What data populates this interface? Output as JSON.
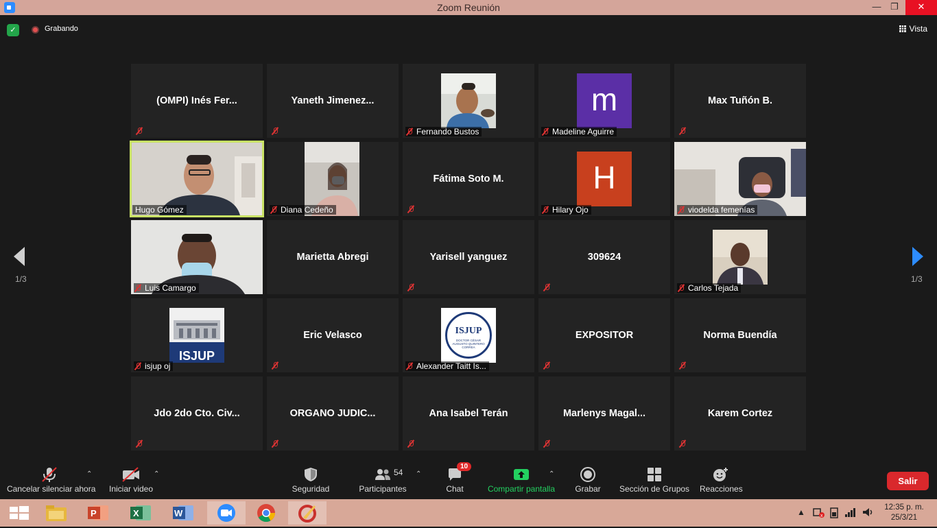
{
  "window": {
    "title": "Zoom Reunión",
    "minimize": "—",
    "restore": "❐",
    "close": "✕"
  },
  "topbar": {
    "recording": "Grabando",
    "view": "Vista"
  },
  "pager": {
    "left": "1/3",
    "right": "1/3"
  },
  "tiles": [
    {
      "id": "t1",
      "big": "(OMPI)  Inés  Fer...",
      "label": ""
    },
    {
      "id": "t2",
      "big": "Yaneth  Jimenez...",
      "label": ""
    },
    {
      "id": "t3",
      "big": "",
      "label": "Fernando Bustos"
    },
    {
      "id": "t4",
      "big": "",
      "label": "Madeline Aguirre",
      "avatar": "m",
      "avatar_color": "#5b2fa6"
    },
    {
      "id": "t5",
      "big": "Max Tuñón B.",
      "label": ""
    },
    {
      "id": "t6",
      "big": "",
      "label": "Hugo Gómez"
    },
    {
      "id": "t7",
      "big": "",
      "label": "Diana Cedeño"
    },
    {
      "id": "t8",
      "big": "Fátima Soto M.",
      "label": ""
    },
    {
      "id": "t9",
      "big": "",
      "label": "Hilary Ojo",
      "avatar": "H",
      "avatar_color": "#c8401e"
    },
    {
      "id": "t10",
      "big": "",
      "label": "viodelda femenías"
    },
    {
      "id": "t11",
      "big": "",
      "label": "Luis Camargo"
    },
    {
      "id": "t12",
      "big": "Marietta Abregi",
      "label": ""
    },
    {
      "id": "t13",
      "big": "Yarisell yanguez",
      "label": ""
    },
    {
      "id": "t14",
      "big": "309624",
      "label": ""
    },
    {
      "id": "t15",
      "big": "",
      "label": "Carlos Tejada"
    },
    {
      "id": "t16",
      "big": "",
      "label": "isjup oj",
      "logo_text": "ISJUP"
    },
    {
      "id": "t17",
      "big": "Eric Velasco",
      "label": ""
    },
    {
      "id": "t18",
      "big": "",
      "label": "Alexander Taitt Is...",
      "logo_text": "ISJUP",
      "logo_sub": "DOCTOR CÉSAR AUGUSTO QUINTERO CORREA"
    },
    {
      "id": "t19",
      "big": "EXPOSITOR",
      "label": ""
    },
    {
      "id": "t20",
      "big": "Norma Buendía",
      "label": ""
    },
    {
      "id": "t21",
      "big": "Jdo  2do  Cto.  Civ...",
      "label": ""
    },
    {
      "id": "t22",
      "big": "ORGANO  JUDIC...",
      "label": ""
    },
    {
      "id": "t23",
      "big": "Ana Isabel Terán",
      "label": ""
    },
    {
      "id": "t24",
      "big": "Marlenys  Magal...",
      "label": ""
    },
    {
      "id": "t25",
      "big": "Karem Cortez",
      "label": ""
    }
  ],
  "toolbar": {
    "mute": "Cancelar silenciar ahora",
    "video": "Iniciar video",
    "security": "Seguridad",
    "participants": "Participantes",
    "participants_count": "54",
    "chat": "Chat",
    "chat_badge": "10",
    "share": "Compartir pantalla",
    "record": "Grabar",
    "breakout": "Sección de Grupos",
    "reactions": "Reacciones",
    "leave": "Salir"
  },
  "taskbar": {
    "time": "12:35 p. m.",
    "date": "25/3/21"
  },
  "colors": {
    "accent": "#2d8cff",
    "active_border": "#c9e265",
    "leave": "#d9282c",
    "share_green": "#23d160"
  }
}
